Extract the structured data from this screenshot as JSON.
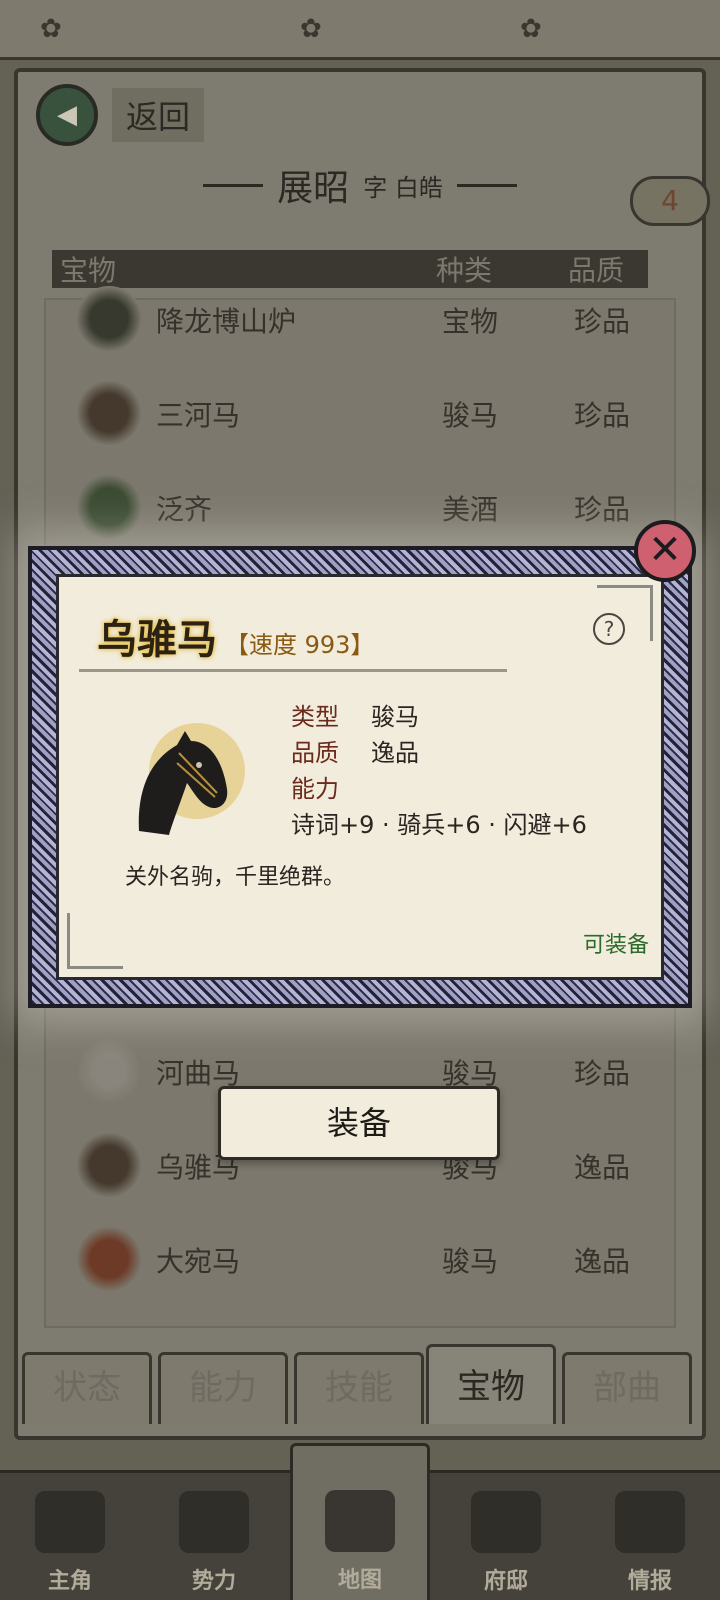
{
  "header": {
    "back_label": "返回",
    "char_name": "展昭",
    "char_zi": "字 白皓",
    "badge": "4"
  },
  "list": {
    "columns": [
      "宝物",
      "种类",
      "品质"
    ],
    "rows": [
      {
        "name": "降龙博山炉",
        "type": "宝物",
        "quality": "珍品"
      },
      {
        "name": "三河马",
        "type": "骏马",
        "quality": "珍品"
      },
      {
        "name": "泛齐",
        "type": "美酒",
        "quality": "珍品"
      },
      {
        "name": "河曲马",
        "type": "骏马",
        "quality": "珍品"
      },
      {
        "name": "乌骓马",
        "type": "骏马",
        "quality": "逸品"
      },
      {
        "name": "大宛马",
        "type": "骏马",
        "quality": "逸品"
      }
    ]
  },
  "tabs": [
    "状态",
    "能力",
    "技能",
    "宝物",
    "部曲"
  ],
  "active_tab": "宝物",
  "bottom_nav": [
    "主角",
    "势力",
    "地图",
    "府邸",
    "情报"
  ],
  "active_nav": "地图",
  "dialog": {
    "item_name": "乌骓马",
    "speed_tag": "【速度 993】",
    "type_label": "类型",
    "type_value": "骏马",
    "quality_label": "品质",
    "quality_value": "逸品",
    "ability_label": "能力",
    "ability_value": "诗词+9 · 骑兵+6 · 闪避+6",
    "description": "关外名驹，千里绝群。",
    "equippable": "可装备",
    "help_icon": "question-icon",
    "close_icon": "close-icon"
  },
  "equip_button": "装备",
  "colors": {
    "close_button": "#cf6070",
    "equippable_text": "#2d6a2d",
    "prop_label": "#6b2a1c"
  }
}
